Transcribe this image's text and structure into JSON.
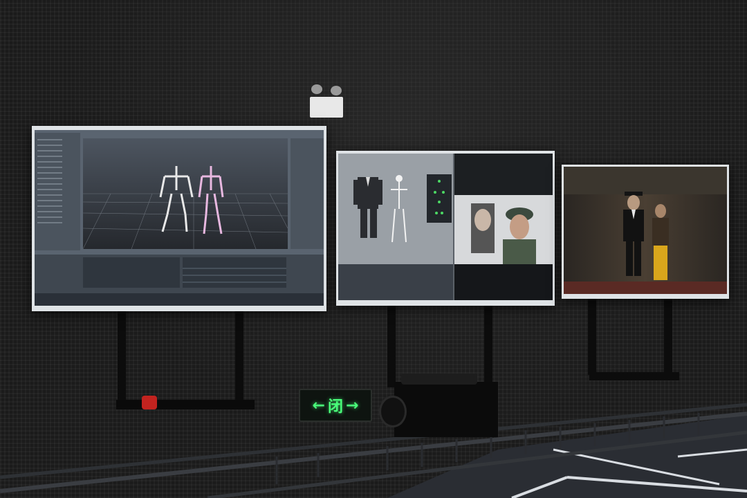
{
  "scene": {
    "description_type": "photo",
    "monitors": [
      {
        "id": "left",
        "content": "motion-capture-software-skeletons"
      },
      {
        "id": "middle",
        "content": "character-rig-and-face-capture"
      },
      {
        "id": "right",
        "content": "rendered-game-scene-characters"
      }
    ]
  },
  "exit_sign": {
    "left_arrow": "←",
    "glyph": "闭",
    "right_arrow": "→",
    "color": "#49ff7a"
  },
  "colors": {
    "wall": "#1b1b1b",
    "floor": "#2a2d33",
    "floor_lines": "#d9dde2",
    "software_bg": "#5a6470",
    "viewport_bg": "#3b4048"
  }
}
